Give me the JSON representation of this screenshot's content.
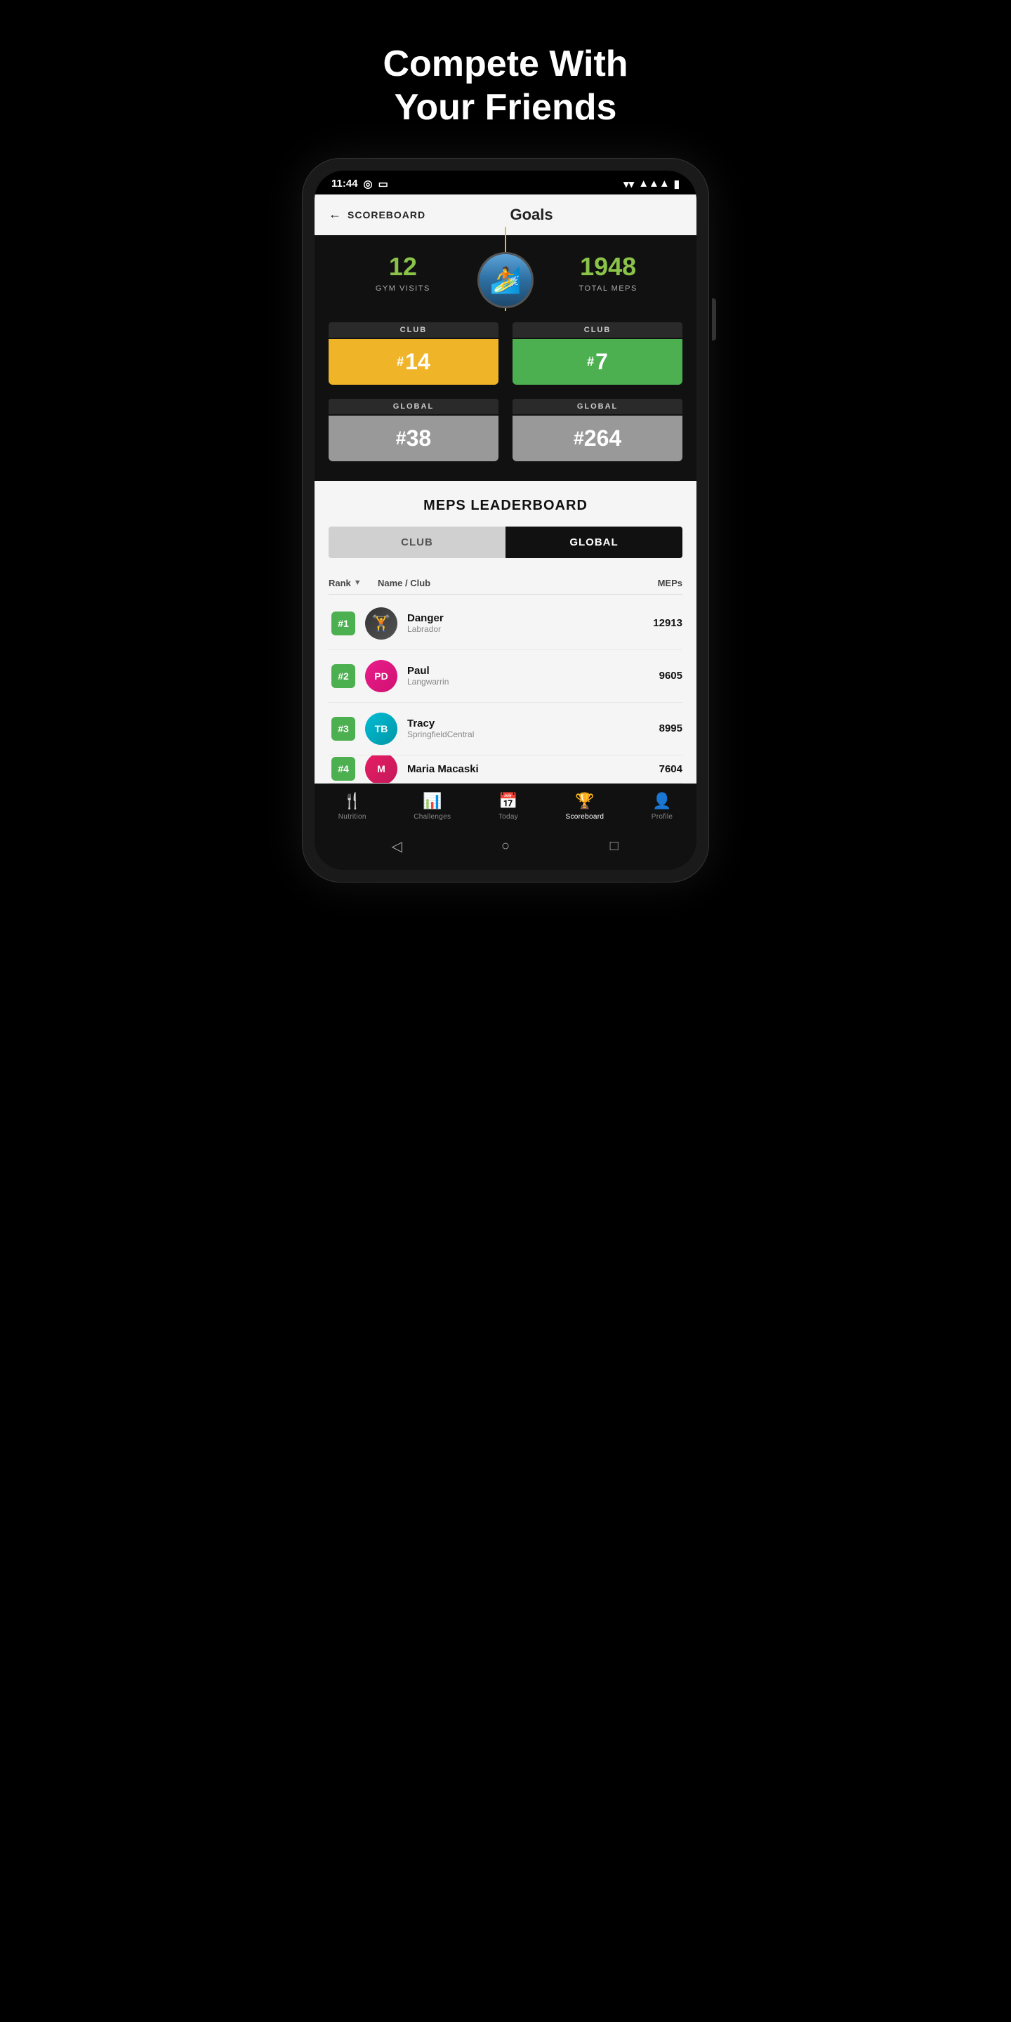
{
  "hero": {
    "title": "Compete With\nYour Friends"
  },
  "statusBar": {
    "time": "11:44",
    "icons": [
      "circle-icon",
      "sd-icon",
      "wifi-icon",
      "signal-icon",
      "battery-icon"
    ]
  },
  "header": {
    "backLabel": "SCOREBOARD",
    "title": "Goals"
  },
  "stats": {
    "gymVisits": "12",
    "gymVisitsLabel": "GYM VISITS",
    "totalMeps": "1948",
    "totalMepsLabel": "TOTAL MEPS",
    "clubRankLabel": "CLUB",
    "clubRankVisits": "#14",
    "clubRankMeps": "#7",
    "globalLabel": "GLOBAL",
    "globalRankVisits": "#38",
    "globalRankMeps": "#264"
  },
  "leaderboard": {
    "title": "MEPS LEADERBOARD",
    "tabClub": "CLUB",
    "tabGlobal": "GLOBAL",
    "activeTab": "global",
    "columns": {
      "rank": "Rank",
      "name": "Name / Club",
      "meps": "MEPs"
    },
    "rows": [
      {
        "rank": "#1",
        "name": "Danger",
        "club": "Labrador",
        "score": "12913",
        "avatarInitials": "",
        "avatarStyle": "danger"
      },
      {
        "rank": "#2",
        "name": "Paul",
        "club": "Langwarrin",
        "score": "9605",
        "avatarInitials": "PD",
        "avatarStyle": "paul"
      },
      {
        "rank": "#3",
        "name": "Tracy",
        "club": "SpringfieldCentral",
        "score": "8995",
        "avatarInitials": "TB",
        "avatarStyle": "tracy"
      },
      {
        "rank": "#4",
        "name": "Maria Macaski",
        "club": "",
        "score": "7604",
        "avatarInitials": "M",
        "avatarStyle": "maria"
      }
    ]
  },
  "bottomNav": {
    "items": [
      {
        "label": "Nutrition",
        "icon": "🍴",
        "active": false
      },
      {
        "label": "Challenges",
        "icon": "📊",
        "active": false
      },
      {
        "label": "Today",
        "icon": "📅",
        "active": false
      },
      {
        "label": "Scoreboard",
        "icon": "🏆",
        "active": true
      },
      {
        "label": "Profile",
        "icon": "👤",
        "active": false
      }
    ]
  }
}
